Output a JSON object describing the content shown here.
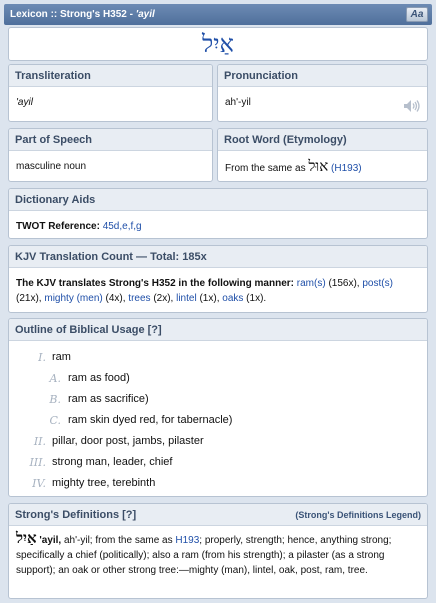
{
  "header": {
    "title_prefix": "Lexicon :: Strong's H352 - ",
    "title_word": "'ayil",
    "aa_label": "Aa"
  },
  "word": {
    "hebrew": "אַיִל"
  },
  "transliteration": {
    "heading": "Transliteration",
    "value": "'ayil"
  },
  "pronunciation": {
    "heading": "Pronunciation",
    "value": "ah'-yil",
    "icon": "speaker-icon"
  },
  "part_of_speech": {
    "heading": "Part of Speech",
    "value": "masculine noun"
  },
  "root_word": {
    "heading": "Root Word (Etymology)",
    "prefix": "From the same as",
    "hebrew": "אוּל",
    "ref": "(H193)"
  },
  "dictionary_aids": {
    "heading": "Dictionary Aids",
    "label": "TWOT Reference:",
    "value": "45d,e,f,g"
  },
  "kjv": {
    "heading": "KJV Translation Count — Total: 185x",
    "intro": "The KJV translates Strong's H352 in the following manner:",
    "items": [
      {
        "word": "ram(s)",
        "count": "(156x)"
      },
      {
        "word": "post(s)",
        "count": "(21x)"
      },
      {
        "word": "mighty (men)",
        "count": "(4x)"
      },
      {
        "word": "trees",
        "count": "(2x)"
      },
      {
        "word": "lintel",
        "count": "(1x)"
      },
      {
        "word": "oaks",
        "count": "(1x)"
      }
    ]
  },
  "outline": {
    "heading": "Outline of Biblical Usage [?]",
    "items": [
      {
        "num": "I.",
        "text": "ram"
      },
      {
        "num": "A.",
        "text": "ram as food)"
      },
      {
        "num": "B.",
        "text": "ram as sacrifice)"
      },
      {
        "num": "C.",
        "text": "ram skin dyed red, for tabernacle)"
      },
      {
        "num": "II.",
        "text": "pillar, door post, jambs, pilaster"
      },
      {
        "num": "III.",
        "text": "strong man, leader, chief"
      },
      {
        "num": "IV.",
        "text": "mighty tree, terebinth"
      }
    ]
  },
  "strongs": {
    "heading": "Strong's Definitions [?]",
    "legend": "(Strong's Definitions Legend)",
    "hebrew": "אַיִל",
    "word": "'ayil,",
    "t1": " ah'-yil; from the same as ",
    "ref": "H193",
    "t2": "; properly, strength; hence, anything strong; specifically a chief (politically); also a ram (from his strength); a pilaster (as a strong support); an oak or other strong tree:—mighty (man), lintel, oak, post, ram, tree."
  }
}
